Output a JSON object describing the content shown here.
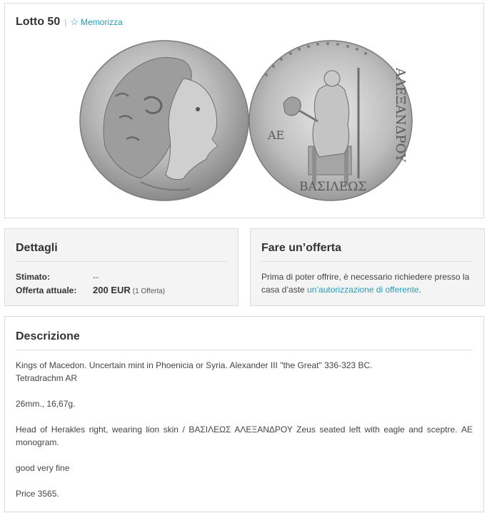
{
  "lot": {
    "title": "Lotto 50",
    "separator": "|",
    "save_label": "Memorizza"
  },
  "images": {
    "obverse_alt": "Coin obverse – head of Herakles in lion skin",
    "reverse_legend_right": "ΑΛΕΞΑΝΔΡΟΥ",
    "reverse_legend_bottom": "ΒΑΣΙΛΕΩΣ",
    "reverse_monogram": "ΑΕ"
  },
  "details": {
    "title": "Dettagli",
    "estimate_label": "Stimato:",
    "estimate_value": "--",
    "current_offer_label": "Offerta attuale:",
    "current_offer_value": "200 EUR",
    "offer_count": "(1 Offerta)"
  },
  "make_offer": {
    "title": "Fare un’offerta",
    "text_before": "Prima di poter offrire, è necessario richiedere presso la casa d’aste ",
    "link_label": "un’autorizzazione di offerente",
    "text_after": "."
  },
  "description": {
    "title": "Descrizione",
    "line1": "Kings of Macedon. Uncertain mint in Phoenicia or Syria. Alexander III \"the Great\" 336-323 BC.",
    "line2": "Tetradrachm AR",
    "size_weight": "26mm., 16,67g.",
    "detail": "Head of Herakles right, wearing lion skin / ΒΑΣΙΛΕΩΣ ΑΛΕΞΑΝΔΡΟΥ Zeus seated left with eagle and sceptre. ΑΕ monogram.",
    "grade": "good very fine",
    "reference": "Price 3565."
  },
  "colors": {
    "link": "#2a9ab8",
    "panel_bg": "#f4f4f4",
    "border": "#dcdcdc"
  }
}
